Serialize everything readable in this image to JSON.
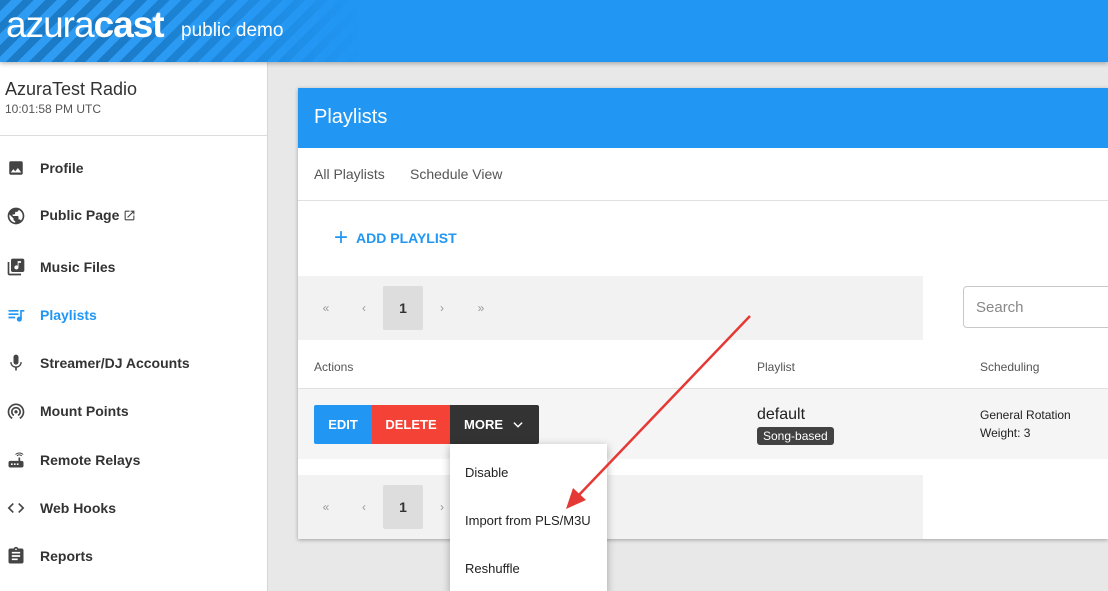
{
  "header": {
    "brand_light": "azura",
    "brand_bold": "cast",
    "subtitle": "public demo"
  },
  "station": {
    "name": "AzuraTest Radio",
    "time": "10:01:58 PM UTC"
  },
  "sidebar": {
    "items": [
      {
        "label": "Profile",
        "icon": "image-icon"
      },
      {
        "label": "Public Page",
        "icon": "globe-icon",
        "external_icon": "external-link-icon"
      },
      {
        "label": "Music Files",
        "icon": "music-library-icon"
      },
      {
        "label": "Playlists",
        "icon": "playlist-icon",
        "active": true
      },
      {
        "label": "Streamer/DJ Accounts",
        "icon": "microphone-icon"
      },
      {
        "label": "Mount Points",
        "icon": "broadcast-icon"
      },
      {
        "label": "Remote Relays",
        "icon": "router-icon"
      },
      {
        "label": "Web Hooks",
        "icon": "code-icon"
      },
      {
        "label": "Reports",
        "icon": "clipboard-icon"
      }
    ]
  },
  "card": {
    "title": "Playlists",
    "tabs": [
      "All Playlists",
      "Schedule View"
    ],
    "add_label": "ADD PLAYLIST",
    "pager": {
      "first": "«",
      "prev": "‹",
      "current": "1",
      "next": "›",
      "last": "»"
    },
    "search_placeholder": "Search",
    "columns": [
      "Actions",
      "Playlist",
      "Scheduling"
    ],
    "row": {
      "edit": "EDIT",
      "delete": "DELETE",
      "more": "MORE",
      "name": "default",
      "badge": "Song-based",
      "schedule_line1": "General Rotation",
      "schedule_line2": "Weight: 3"
    }
  },
  "dropdown": {
    "items": [
      "Disable",
      "Import from PLS/M3U",
      "Reshuffle"
    ]
  },
  "colors": {
    "primary": "#2196f3",
    "danger": "#f44336",
    "dark": "#333333",
    "annotation": "#e53935"
  }
}
